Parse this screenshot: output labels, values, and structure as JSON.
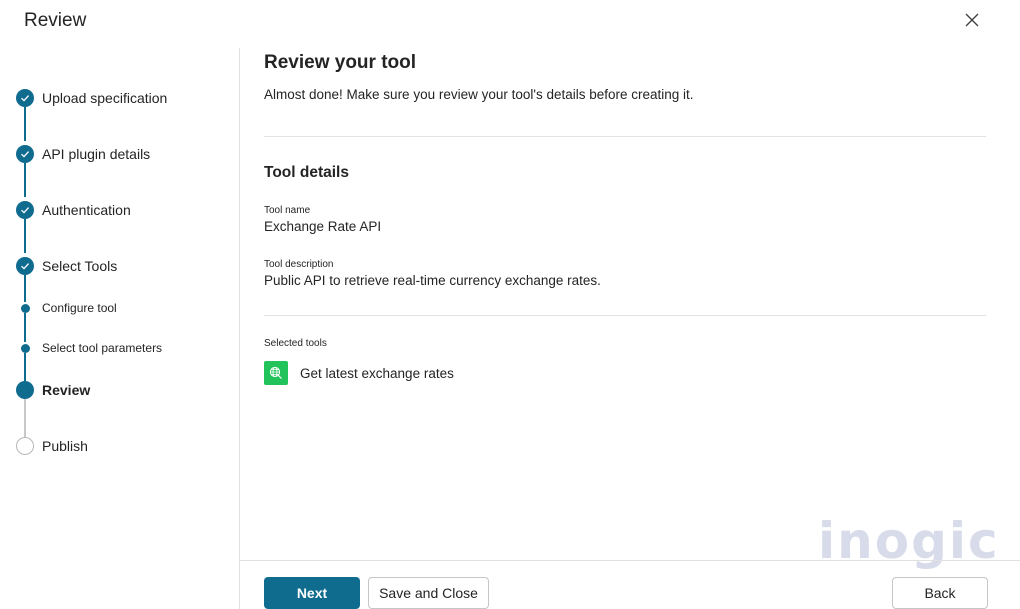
{
  "dialog": {
    "title": "Review",
    "close_icon": "close-icon"
  },
  "stepper": {
    "accent_color": "#0f6c8f",
    "steps": [
      {
        "label": "Upload specification",
        "state": "completed"
      },
      {
        "label": "API plugin details",
        "state": "completed"
      },
      {
        "label": "Authentication",
        "state": "completed"
      },
      {
        "label": "Select Tools",
        "state": "completed"
      },
      {
        "label": "Configure tool",
        "state": "substep"
      },
      {
        "label": "Select tool parameters",
        "state": "substep"
      },
      {
        "label": "Review",
        "state": "current"
      },
      {
        "label": "Publish",
        "state": "upcoming"
      }
    ]
  },
  "main": {
    "title": "Review your tool",
    "subtitle": "Almost done! Make sure you review your tool's details before creating it.",
    "section_title": "Tool details",
    "tool_name_label": "Tool name",
    "tool_name_value": "Exchange Rate API",
    "tool_description_label": "Tool description",
    "tool_description_value": "Public API to retrieve real-time currency exchange rates.",
    "selected_tools_label": "Selected tools",
    "selected_tools": [
      {
        "name": "Get latest exchange rates",
        "icon": "globe-icon",
        "icon_color": "#21c35a"
      }
    ]
  },
  "footer": {
    "next_label": "Next",
    "save_close_label": "Save and Close",
    "back_label": "Back"
  },
  "watermark": {
    "text": "inogic"
  }
}
